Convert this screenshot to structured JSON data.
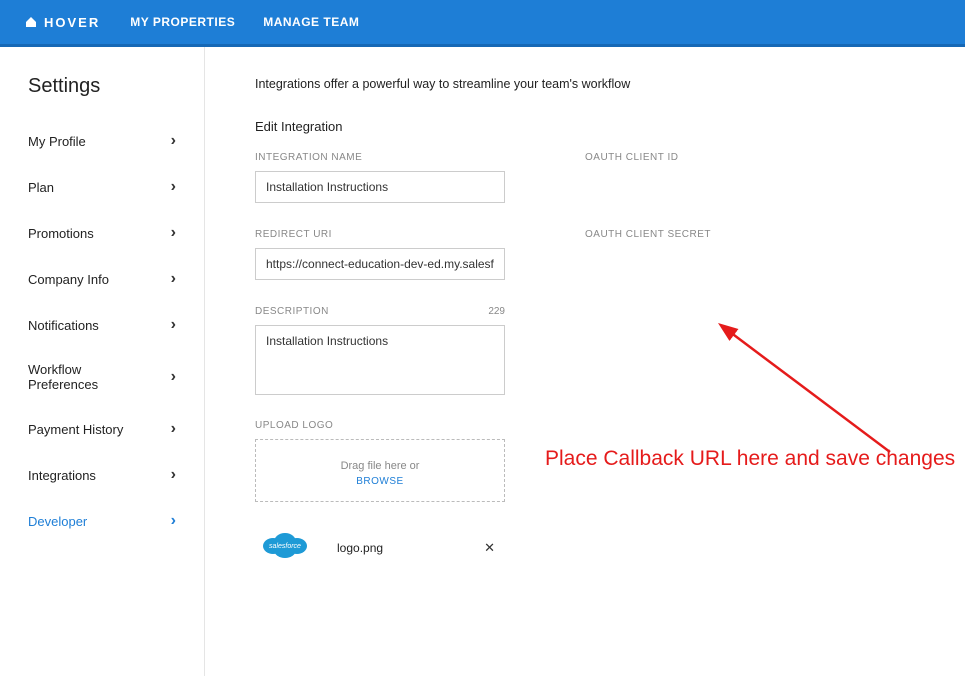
{
  "brand": "HOVER",
  "nav": {
    "my_properties": "MY PROPERTIES",
    "manage_team": "MANAGE TEAM"
  },
  "sidebar": {
    "title": "Settings",
    "items": [
      {
        "label": "My Profile"
      },
      {
        "label": "Plan"
      },
      {
        "label": "Promotions"
      },
      {
        "label": "Company Info"
      },
      {
        "label": "Notifications"
      },
      {
        "label": "Workflow Preferences"
      },
      {
        "label": "Payment History"
      },
      {
        "label": "Integrations"
      },
      {
        "label": "Developer"
      }
    ]
  },
  "intro": "Integrations offer a powerful way to streamline your team's workflow",
  "edit_title": "Edit Integration",
  "labels": {
    "integration_name": "INTEGRATION NAME",
    "oauth_client_id": "OAUTH CLIENT ID",
    "redirect_uri": "REDIRECT URI",
    "oauth_client_secret": "OAUTH CLIENT SECRET",
    "description": "DESCRIPTION",
    "upload_logo": "UPLOAD LOGO"
  },
  "values": {
    "integration_name": "Installation Instructions",
    "redirect_uri": "https://connect-education-dev-ed.my.salesforce.c",
    "description": "Installation Instructions",
    "description_count": "229"
  },
  "upload": {
    "drag_text": "Drag file here or",
    "browse": "BROWSE",
    "file_name": "logo.png"
  },
  "annotation": "Place Callback URL here and save changes"
}
